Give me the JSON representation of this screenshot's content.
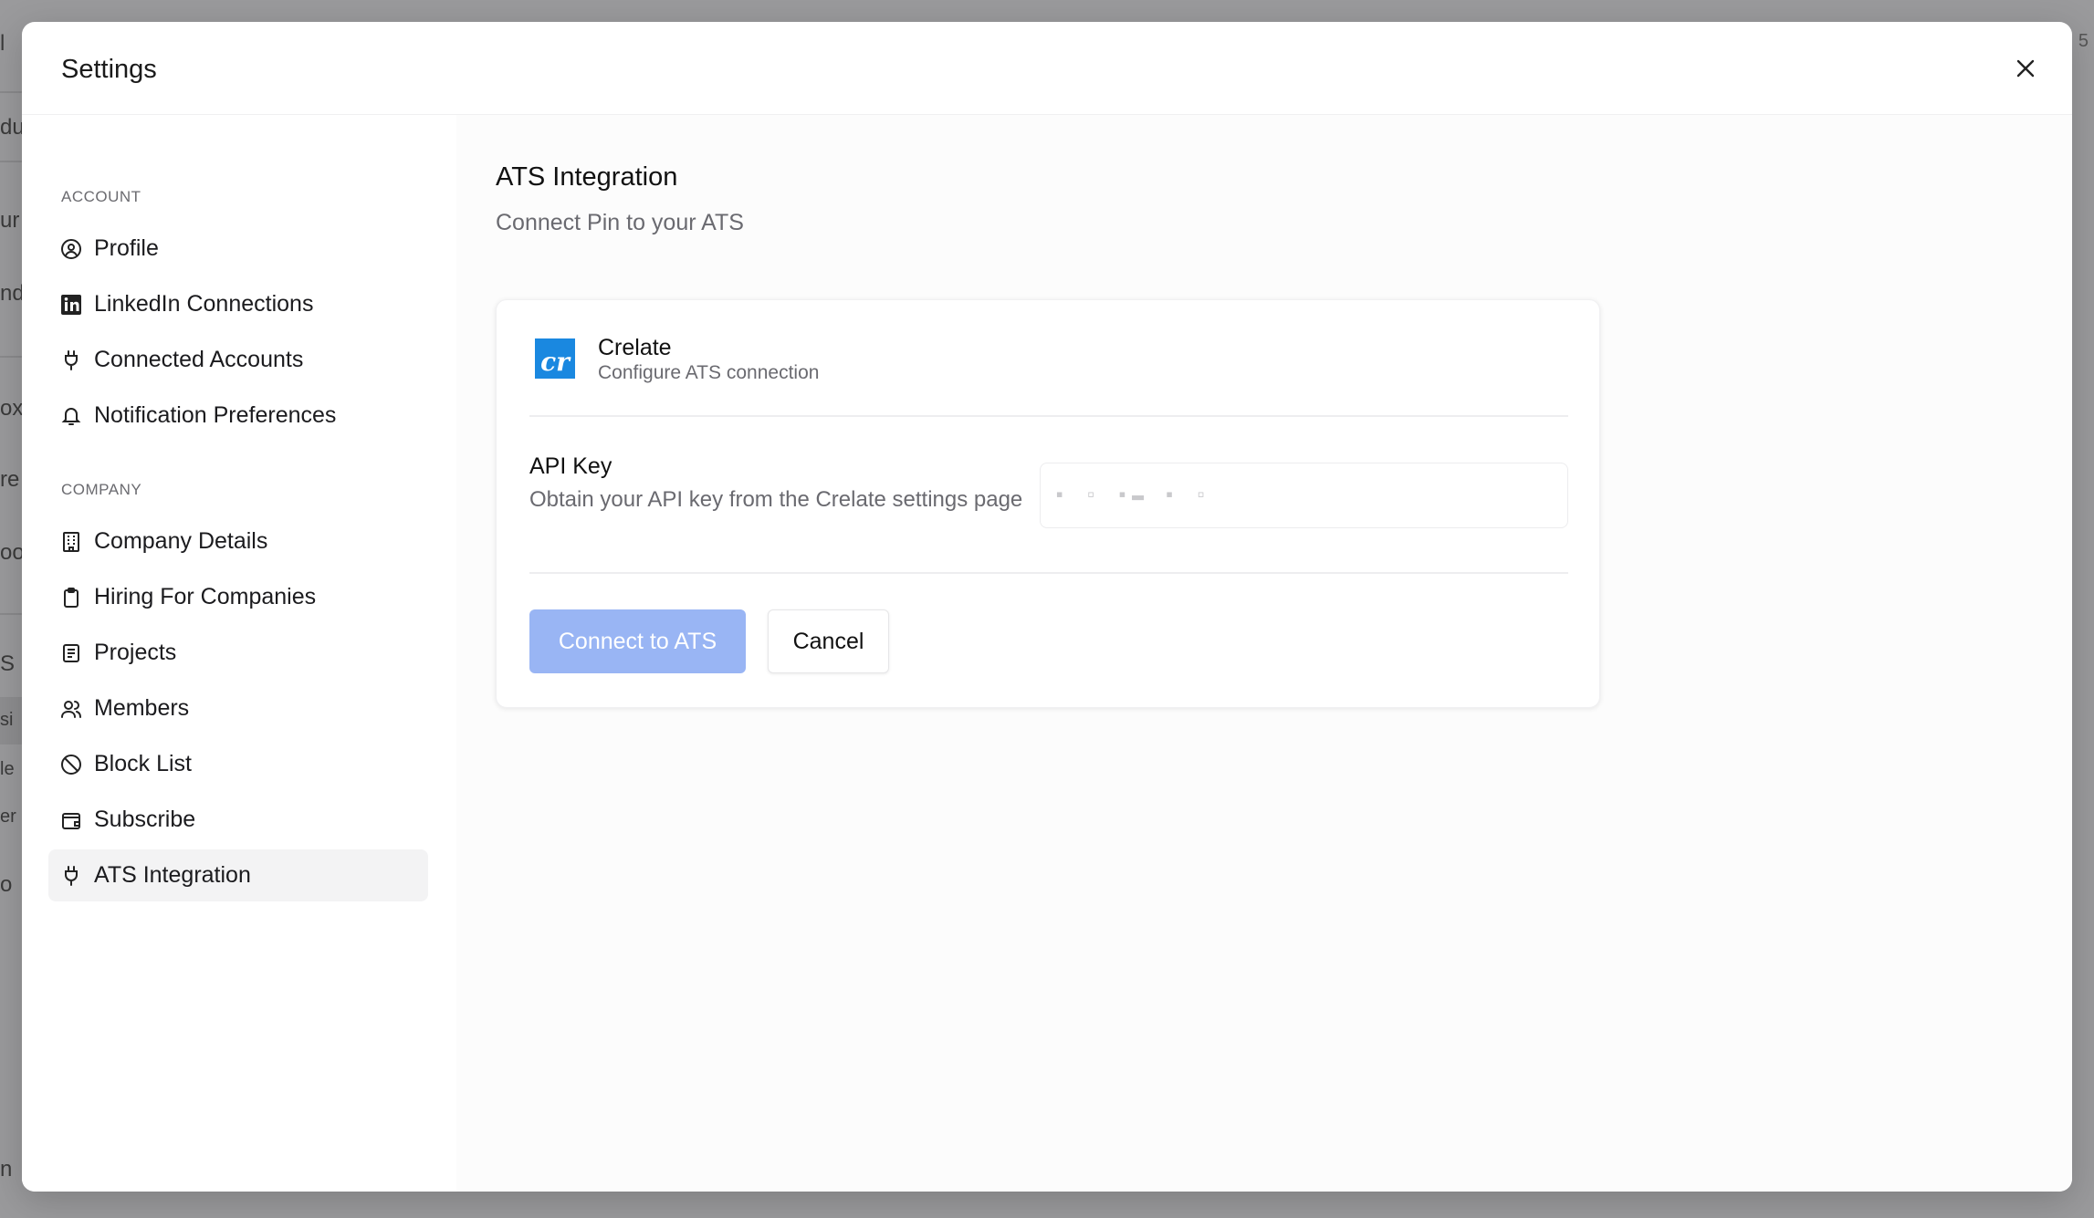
{
  "background": {
    "fragments": [
      "l",
      "du",
      "ur",
      "nd",
      "ox",
      "re",
      "oo",
      "S",
      "si",
      "le",
      "er",
      "o",
      "n"
    ],
    "right_fragment": "5"
  },
  "modal": {
    "title": "Settings",
    "close_icon": "close-icon"
  },
  "sidebar": {
    "sections": [
      {
        "title": "ACCOUNT",
        "items": [
          {
            "label": "Profile",
            "icon": "user-circle-icon"
          },
          {
            "label": "LinkedIn Connections",
            "icon": "linkedin-icon"
          },
          {
            "label": "Connected Accounts",
            "icon": "plug-icon"
          },
          {
            "label": "Notification Preferences",
            "icon": "bell-icon"
          }
        ]
      },
      {
        "title": "COMPANY",
        "items": [
          {
            "label": "Company Details",
            "icon": "building-icon"
          },
          {
            "label": "Hiring For Companies",
            "icon": "clipboard-icon"
          },
          {
            "label": "Projects",
            "icon": "list-icon"
          },
          {
            "label": "Members",
            "icon": "users-icon"
          },
          {
            "label": "Block List",
            "icon": "block-icon"
          },
          {
            "label": "Subscribe",
            "icon": "wallet-icon"
          },
          {
            "label": "ATS Integration",
            "icon": "plug-icon",
            "active": true
          }
        ]
      }
    ]
  },
  "content": {
    "title": "ATS Integration",
    "subtitle": "Connect Pin to your ATS",
    "card": {
      "logo_text": "cr",
      "provider_name": "Crelate",
      "provider_desc": "Configure ATS connection",
      "api_key_label": "API Key",
      "api_key_help": "Obtain your API key from the Crelate settings page",
      "api_key_value": "▪ ▫ ▪▬ ▪ ▫",
      "connect_label": "Connect to ATS",
      "cancel_label": "Cancel"
    }
  },
  "colors": {
    "primary_disabled": "#99b5f4",
    "logo_blue": "#1a88e0",
    "active_item_bg": "#f3f3f4"
  }
}
